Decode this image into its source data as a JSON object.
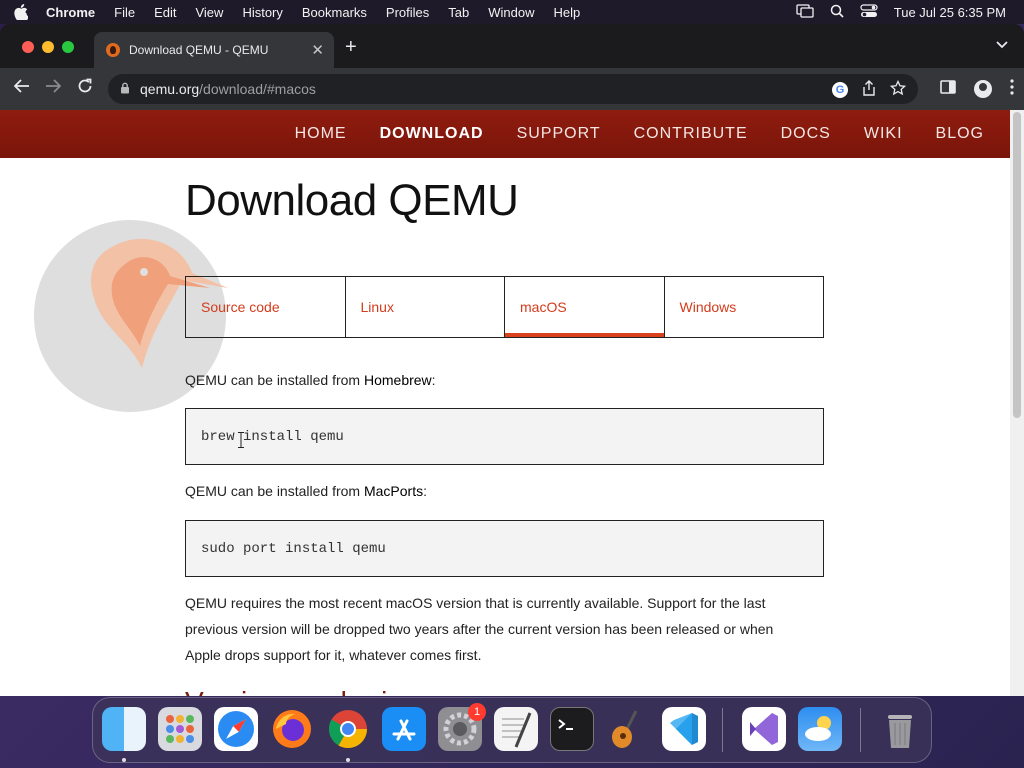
{
  "menubar": {
    "app": "Chrome",
    "items": [
      "File",
      "Edit",
      "View",
      "History",
      "Bookmarks",
      "Profiles",
      "Tab",
      "Window",
      "Help"
    ],
    "clock": "Tue Jul 25  6:35 PM"
  },
  "browser": {
    "tab_title": "Download QEMU - QEMU",
    "url_host": "qemu.org",
    "url_path": "/download/#macos"
  },
  "site": {
    "nav": [
      "HOME",
      "DOWNLOAD",
      "SUPPORT",
      "CONTRIBUTE",
      "DOCS",
      "WIKI",
      "BLOG"
    ],
    "active_nav": "DOWNLOAD"
  },
  "page": {
    "title": "Download QEMU",
    "os_tabs": [
      "Source code",
      "Linux",
      "macOS",
      "Windows"
    ],
    "active_os_tab": "macOS",
    "homebrew_prefix": "QEMU can be installed from ",
    "homebrew_link": "Homebrew",
    "homebrew_suffix": ":",
    "homebrew_cmd": "brew install qemu",
    "macports_prefix": "QEMU can be installed from ",
    "macports_link": "MacPorts",
    "macports_suffix": ":",
    "macports_cmd": "sudo port install qemu",
    "requirements": "QEMU requires the most recent macOS version that is currently available. Support for the last previous version will be dropped two years after the current version has been released or when Apple drops support for it, whatever comes first.",
    "section_title": "Version numbering"
  },
  "dock": {
    "apps": [
      "finder",
      "launchpad",
      "safari",
      "firefox",
      "chrome",
      "app-store",
      "system-settings",
      "textedit",
      "terminal",
      "garageband",
      "vscode",
      "visual-studio",
      "weather",
      "trash"
    ],
    "settings_badge": "1"
  },
  "colors": {
    "site_nav_bg": "#8f1c0f",
    "accent": "#d9421d",
    "section_title": "#7a1e0c"
  }
}
